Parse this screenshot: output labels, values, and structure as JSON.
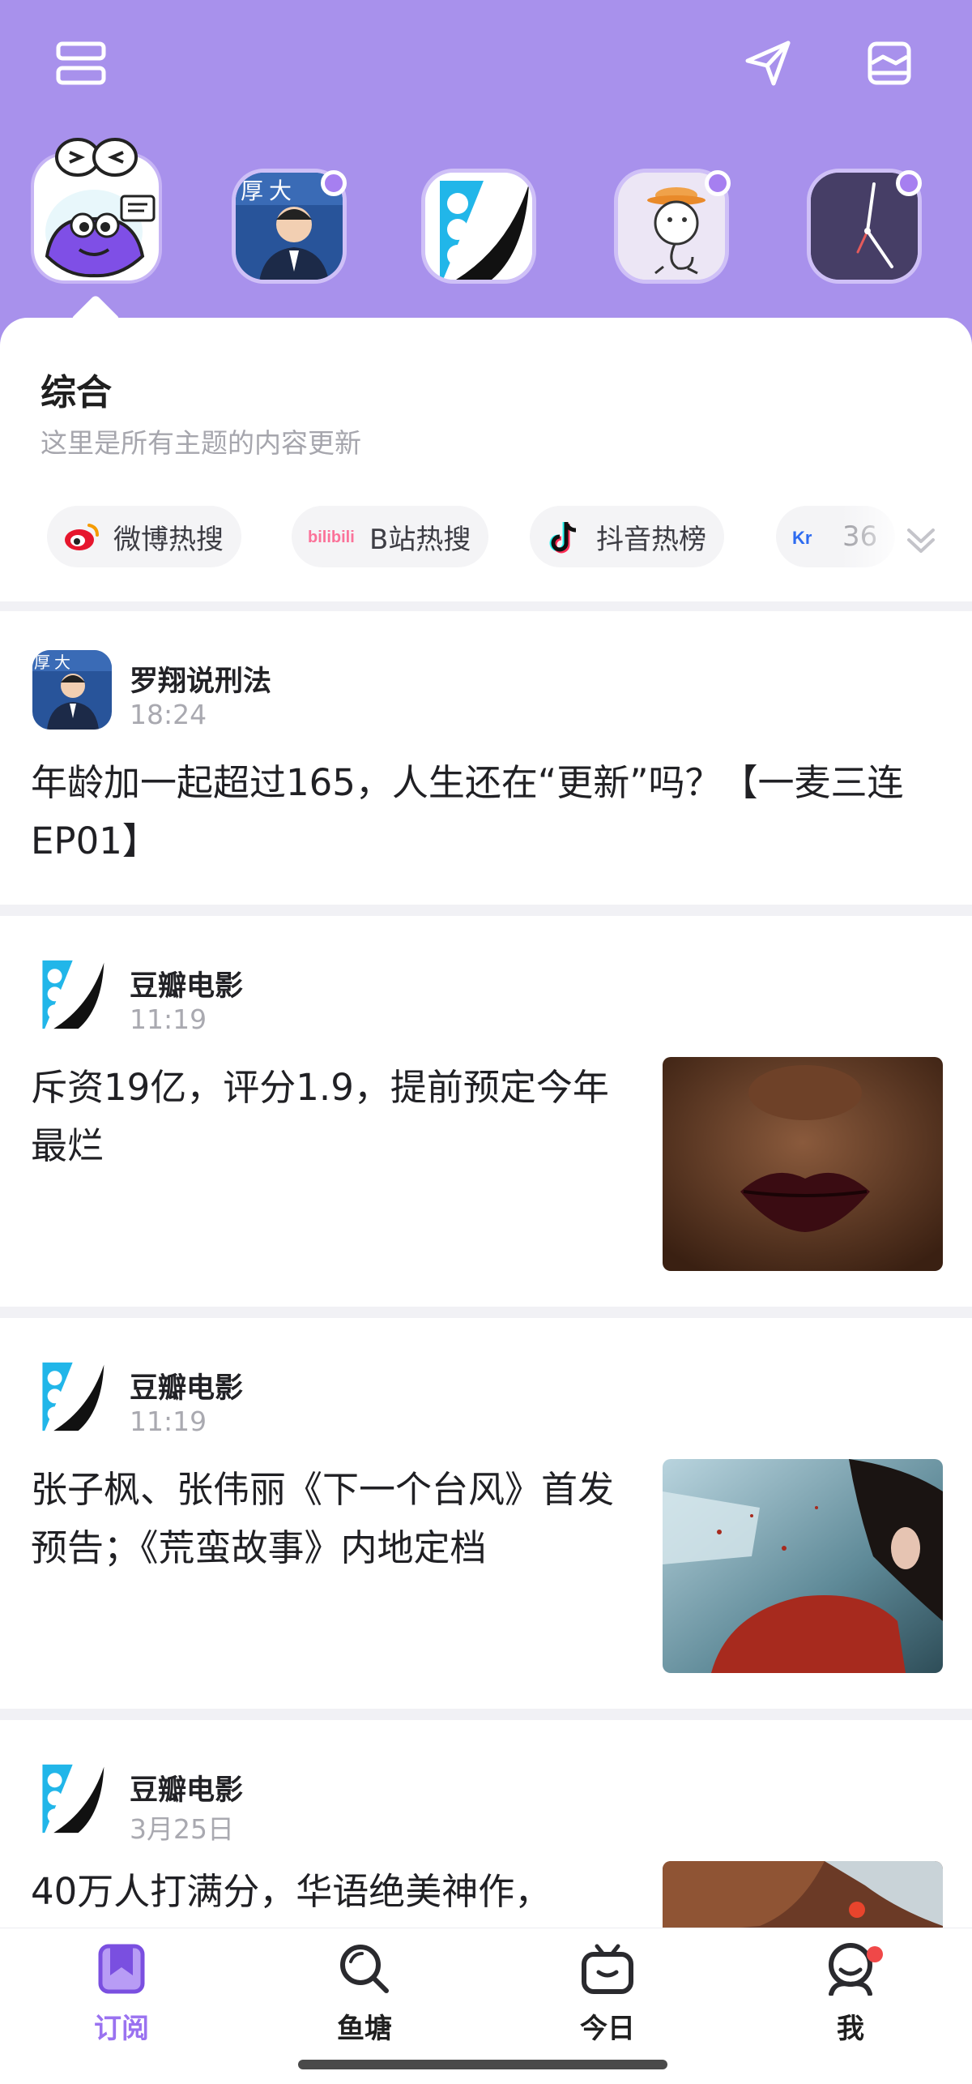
{
  "subscriptions": [
    {
      "name": "mascot",
      "selected": true
    },
    {
      "name": "luoxiang",
      "has_update": true
    },
    {
      "name": "douban-movie",
      "has_update": false
    },
    {
      "name": "doodle",
      "has_update": true
    },
    {
      "name": "clock",
      "has_update": true
    }
  ],
  "section": {
    "title": "综合",
    "subtitle": "这里是所有主题的内容更新"
  },
  "chips": [
    {
      "label": "微博热搜",
      "icon": "weibo-icon"
    },
    {
      "label": "B站热搜",
      "icon": "bilibili-icon"
    },
    {
      "label": "抖音热榜",
      "icon": "douyin-icon"
    },
    {
      "label": "36",
      "icon": "36kr-icon"
    }
  ],
  "feed": [
    {
      "source": "罗翔说刑法",
      "time": "18:24",
      "title": "年龄加一起超过165，人生还在“更新”吗？【一麦三连EP01】"
    },
    {
      "source": "豆瓣电影",
      "time": "11:19",
      "title": "斥资19亿，评分1.9，提前预定今年最烂"
    },
    {
      "source": "豆瓣电影",
      "time": "11:19",
      "title": "张子枫、张伟丽《下一个台风》首发预告；《荒蛮故事》内地定档"
    },
    {
      "source": "豆瓣电影",
      "time": "3月25日",
      "title": "40万人打满分，华语绝美神作，"
    }
  ],
  "bottom_nav": [
    {
      "label": "订阅",
      "icon": "bookmark-icon",
      "active": true
    },
    {
      "label": "鱼塘",
      "icon": "search-icon",
      "active": false
    },
    {
      "label": "今日",
      "icon": "tv-icon",
      "active": false
    },
    {
      "label": "我",
      "icon": "profile-icon",
      "active": false,
      "badge": true
    }
  ],
  "colors": {
    "header_bg": "#a891ec",
    "accent": "#9a72f0",
    "badge": "#f04848"
  }
}
